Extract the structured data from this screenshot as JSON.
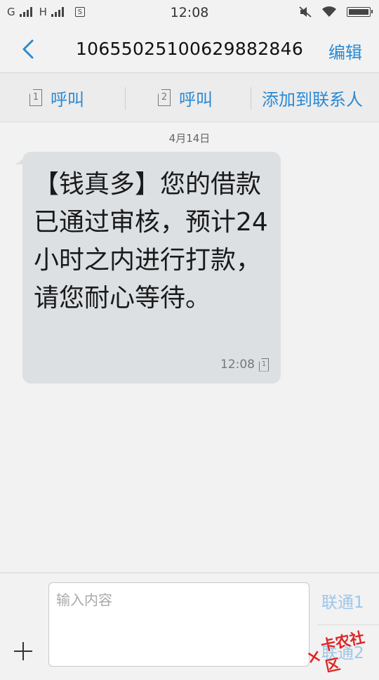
{
  "status_bar": {
    "network_1": "G",
    "network_2": "H",
    "sim_badge": "S",
    "time": "12:08"
  },
  "header": {
    "title": "10655025100629882846",
    "edit_label": "编辑"
  },
  "actions": {
    "call_sim1_label": "呼叫",
    "call_sim1_badge": "1",
    "call_sim2_label": "呼叫",
    "call_sim2_badge": "2",
    "add_contact_label": "添加到联系人"
  },
  "conversation": {
    "date": "4月14日",
    "message": {
      "text": "【钱真多】您的借款已通过审核，预计24小时之内进行打款，请您耐心等待。",
      "time": "12:08",
      "sim_badge": "1"
    }
  },
  "composer": {
    "placeholder": "输入内容",
    "send_sim1": "联通1",
    "send_sim2": "联通2"
  },
  "watermark": {
    "text": "卡农社区"
  },
  "colors": {
    "accent": "#2a8ad4",
    "bubble": "#dde0e3",
    "send_disabled": "#9cc6ea",
    "watermark": "#e02424"
  }
}
